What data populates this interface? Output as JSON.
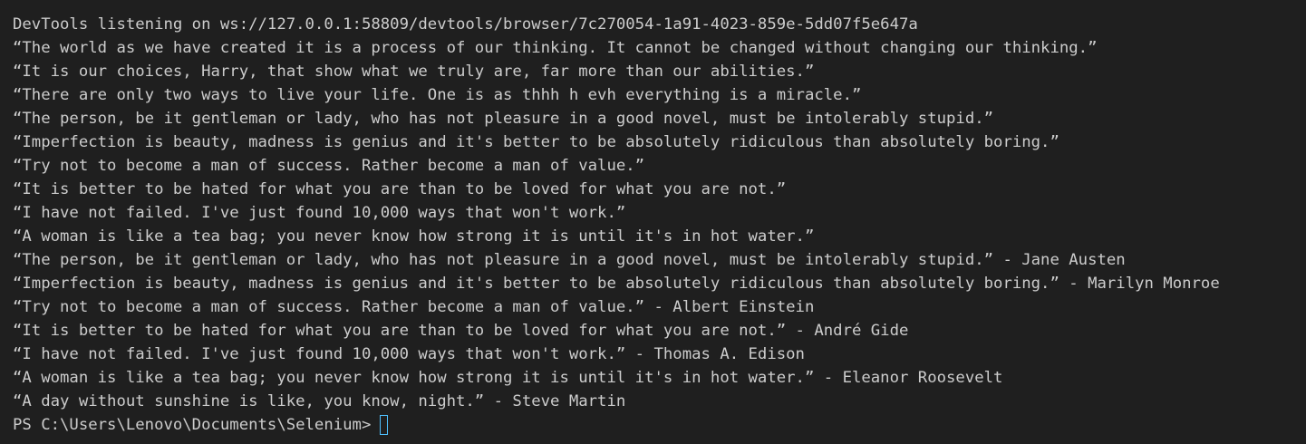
{
  "terminal": {
    "lines": [
      "DevTools listening on ws://127.0.0.1:58809/devtools/browser/7c270054-1a91-4023-859e-5dd07f5e647a",
      "“The world as we have created it is a process of our thinking. It cannot be changed without changing our thinking.”",
      "“It is our choices, Harry, that show what we truly are, far more than our abilities.”",
      "“There are only two ways to live your life. One is as thhh h evh everything is a miracle.”",
      "“The person, be it gentleman or lady, who has not pleasure in a good novel, must be intolerably stupid.”",
      "“Imperfection is beauty, madness is genius and it's better to be absolutely ridiculous than absolutely boring.”",
      "“Try not to become a man of success. Rather become a man of value.”",
      "“It is better to be hated for what you are than to be loved for what you are not.”",
      "“I have not failed. I've just found 10,000 ways that won't work.”",
      "“A woman is like a tea bag; you never know how strong it is until it's in hot water.”",
      "“The person, be it gentleman or lady, who has not pleasure in a good novel, must be intolerably stupid.” - Jane Austen",
      "“Imperfection is beauty, madness is genius and it's better to be absolutely ridiculous than absolutely boring.” - Marilyn Monroe",
      "“Try not to become a man of success. Rather become a man of value.” - Albert Einstein",
      "“It is better to be hated for what you are than to be loved for what you are not.” - André Gide",
      "“I have not failed. I've just found 10,000 ways that won't work.” - Thomas A. Edison",
      "“A woman is like a tea bag; you never know how strong it is until it's in hot water.” - Eleanor Roosevelt",
      "“A day without sunshine is like, you know, night.” - Steve Martin"
    ],
    "prompt": "PS C:\\Users\\Lenovo\\Documents\\Selenium>",
    "colors": {
      "background": "#1f1f1f",
      "text": "#cccccc",
      "cursor": "#4fc1ff"
    }
  }
}
